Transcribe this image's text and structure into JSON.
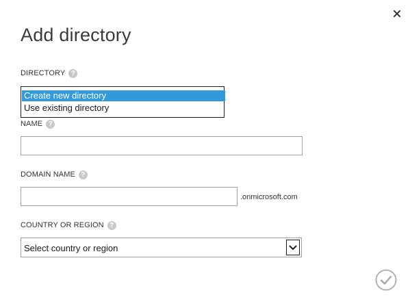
{
  "dialog": {
    "title": "Add directory",
    "close_icon": "close-icon",
    "confirm_icon": "checkmark-circle-icon"
  },
  "directory": {
    "label": "DIRECTORY",
    "help_icon": "help-icon",
    "options": [
      {
        "label": "Create new directory",
        "selected": true
      },
      {
        "label": "Use existing directory",
        "selected": false
      }
    ]
  },
  "name": {
    "label": "NAME",
    "value": "",
    "placeholder": ""
  },
  "domain_name": {
    "label": "DOMAIN NAME",
    "value": "",
    "placeholder": "",
    "suffix": ".onmicrosoft.com"
  },
  "country": {
    "label": "COUNTRY OR REGION",
    "selected": "Select country or region"
  },
  "colors": {
    "selection": "#3399dd",
    "help_icon": "#c8c8c8",
    "confirm_ring": "#b4b4b4"
  }
}
